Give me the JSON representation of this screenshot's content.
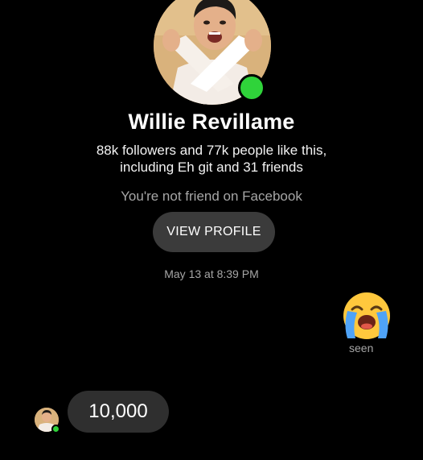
{
  "contact": {
    "name": "Willie Revillame",
    "meta_line_1": "88k followers and 77k people like this,",
    "meta_line_2": "including Eh git and 31 friends",
    "friend_status": "You're not friend on Facebook",
    "online": true
  },
  "actions": {
    "view_profile_label": "VIEW PROFILE"
  },
  "conversation": {
    "timestamp": "May 13 at 8:39 PM",
    "messages": [
      {
        "sender": "me",
        "type": "emoji",
        "emoji": "loudly-crying-face",
        "status": "seen"
      },
      {
        "sender": "contact",
        "type": "text",
        "text": "10,000"
      }
    ]
  },
  "colors": {
    "background": "#000000",
    "online_green": "#2fd33a",
    "bubble": "#2f2f2f",
    "button": "#3b3b3b",
    "muted_text": "#a6a6a6"
  }
}
